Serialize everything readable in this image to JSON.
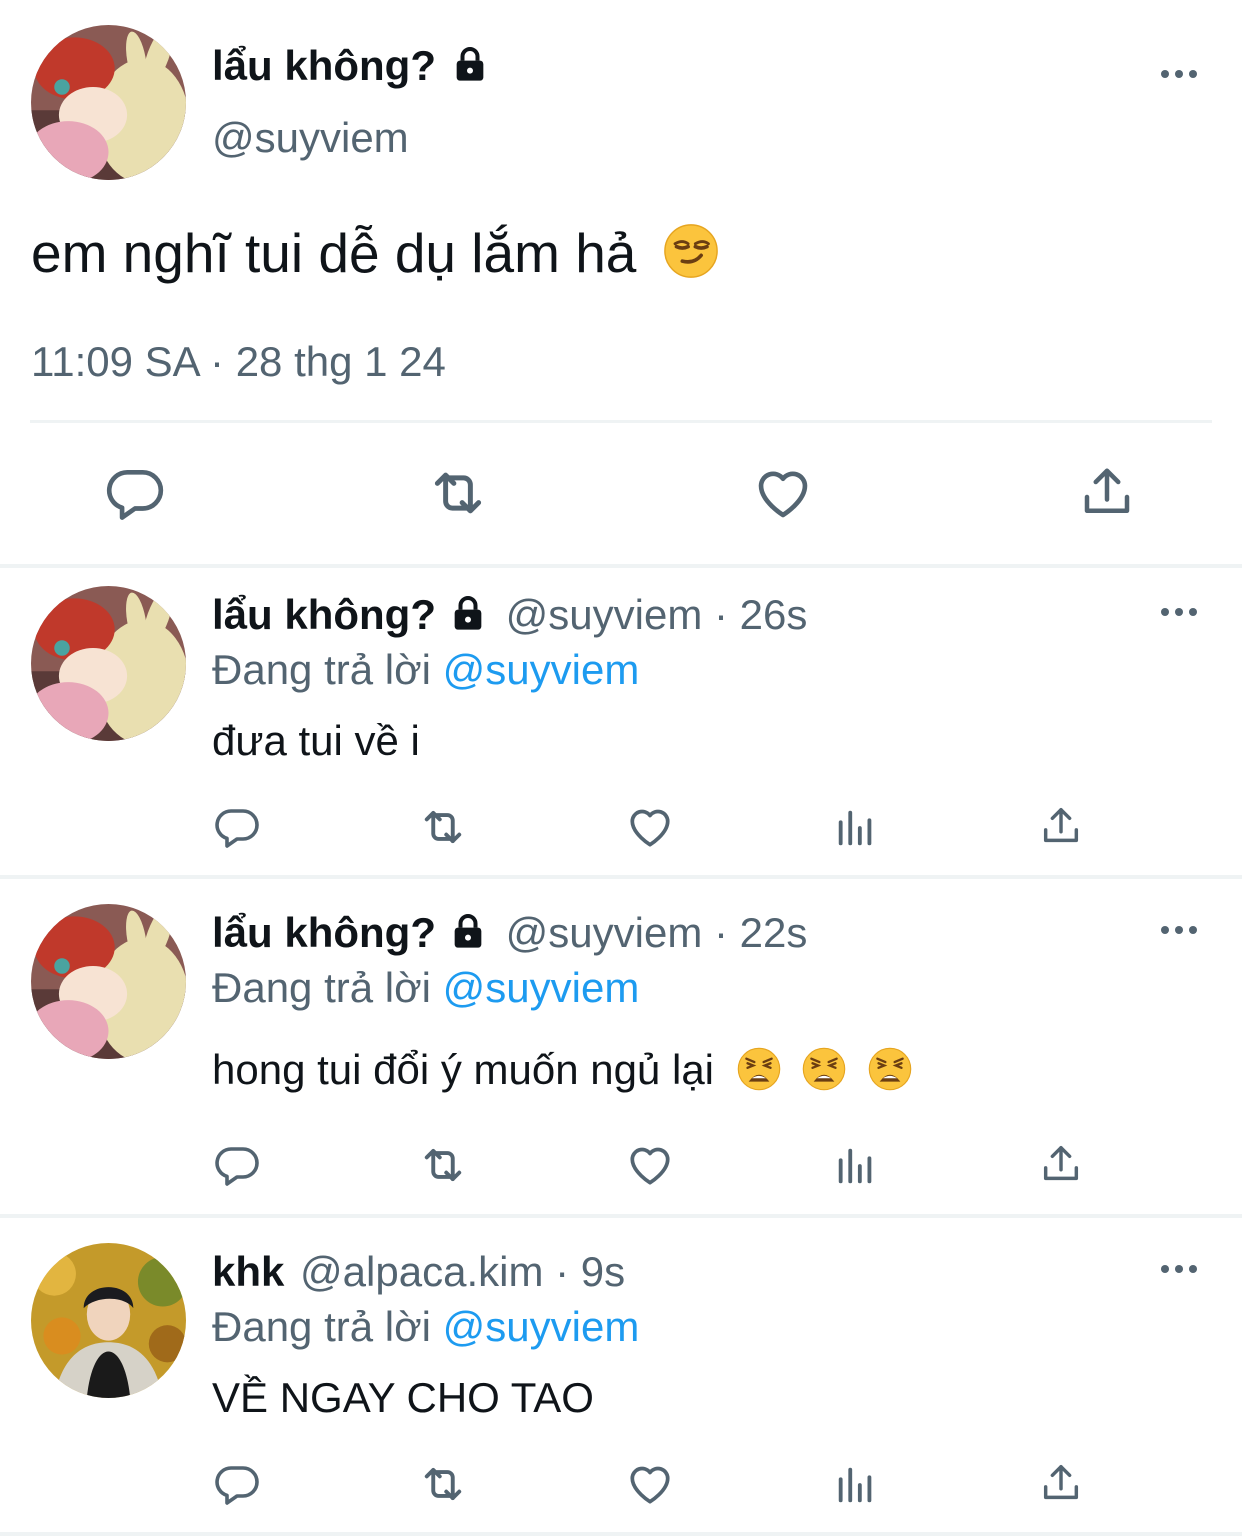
{
  "main_tweet": {
    "display_name": "lẩu không?",
    "handle": "@suyviem",
    "text": "em nghĩ tui dễ dụ lắm hả",
    "timestamp": "11:09 SA · 28 thg 1 24"
  },
  "replies": [
    {
      "display_name": "lẩu không?",
      "handle_time": "@suyviem · 26s",
      "replying_prefix": "Đang trả lời",
      "replying_to": "@suyviem",
      "text": "đưa tui về i"
    },
    {
      "display_name": "lẩu không?",
      "handle_time": "@suyviem · 22s",
      "replying_prefix": "Đang trả lời",
      "replying_to": "@suyviem",
      "text": "hong tui đổi ý muốn ngủ lại"
    },
    {
      "display_name": "khk",
      "handle_time": "@alpaca.kim · 9s",
      "replying_prefix": "Đang trả lời",
      "replying_to": "@suyviem",
      "text": "VỀ NGAY CHO TAO"
    }
  ],
  "icons": {
    "lock": "lock-icon",
    "more": "more-horizontal-icon",
    "reply": "reply-icon",
    "retweet": "retweet-icon",
    "like": "heart-icon",
    "views": "views-chart-icon",
    "share": "share-icon",
    "smirk": "smirking-face-emoji",
    "weary": "weary-face-emoji"
  },
  "colors": {
    "text": "#0f1419",
    "secondary": "#536471",
    "accent": "#1d9bf0",
    "separator": "#eff3f4"
  }
}
